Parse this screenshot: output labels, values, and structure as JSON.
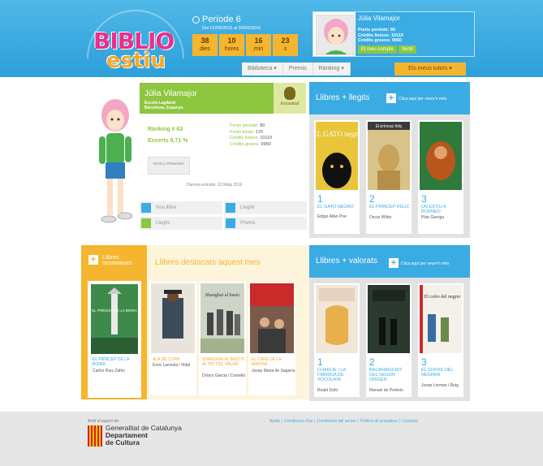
{
  "logo": {
    "line1": "BIBLIO",
    "line2": "estiu"
  },
  "period": {
    "title": "Període 6",
    "dates": "Del 01/06/2016 al 30/06/2016"
  },
  "countdown": [
    {
      "value": "38",
      "unit": "dies"
    },
    {
      "value": "10",
      "unit": "hores"
    },
    {
      "value": "16",
      "unit": "min"
    },
    {
      "value": "23",
      "unit": "s"
    }
  ],
  "user": {
    "name": "Júlia Vilamajor",
    "stats": [
      "Punts període: 80",
      "Crèdits lleixos: 10110",
      "Crèdits gresos: 9950"
    ],
    "account_btn": "El meu compte",
    "logout_btn": "Sortir"
  },
  "nav": {
    "items": [
      "Biblioteca ▾",
      "Premis",
      "Rànking ▾"
    ],
    "tutor": "Els meus tutors ▾"
  },
  "profile": {
    "name": "Júlia Vilamajor",
    "school": "Escola Lagiland",
    "location": "Barcelona, Espanya",
    "badge": "Escarabat",
    "ranking": "Rànking # 63",
    "encerts": "Encerts 9,71 %",
    "stats": [
      {
        "label": "Punts període:",
        "value": "80"
      },
      {
        "label": "Punts totals:",
        "value": "170"
      },
      {
        "label": "Crèdits lleixos:",
        "value": "10110"
      },
      {
        "label": "Crèdits gresos:",
        "value": "9950"
      }
    ],
    "level_btn": "NIVELL PRIMARIA",
    "last_access": "Darrera entrada: 22 Maig 2016"
  },
  "quick_links": [
    {
      "label": "Nou llibre",
      "color": "blue"
    },
    {
      "label": "Llegint",
      "color": "blue"
    },
    {
      "label": "Llegits",
      "color": "green"
    },
    {
      "label": "Premis",
      "color": "blue"
    }
  ],
  "most_read": {
    "title": "Llibres + llegits",
    "click": "Clica aquí per veure'n més",
    "books": [
      {
        "num": "1",
        "title": "EL GATO NEGRO",
        "author": "Edgar Allan Poe",
        "cover_text": "EL GATO negro"
      },
      {
        "num": "2",
        "title": "EL PRÍNCEP FELIÇ",
        "author": "Oscar Wilde",
        "cover_text": "El príncep feliç"
      },
      {
        "num": "3",
        "title": "UN ESTIU A BORNEO",
        "author": "Pilar Garriga",
        "cover_text": ""
      }
    ]
  },
  "recommended": {
    "title": "Llibres recomanats",
    "book": {
      "title": "EL PRÍNCEP DE LA BOIRA",
      "author": "Carlos Ruiz Zafón",
      "cover_text": "EL PRÍNCEP DE LA BOIRA"
    }
  },
  "featured": {
    "title": "Llibres destacats aquest mes",
    "books": [
      {
        "title": "ALA DE CORB",
        "author": "Enric Larreula i Vidal"
      },
      {
        "title": "SHANGHAI AL BASTÓ, AL PIC DEL VALOR",
        "author": "Dolors Garcia i Cornellà",
        "cover_text": "Shanghai al basto"
      },
      {
        "title": "EL CAFÈ DE LA MARINA",
        "author": "Josep Maria de Sagarra"
      }
    ]
  },
  "top_rated": {
    "title": "Llibres + valorats",
    "click": "Clica aquí per veure'n més",
    "books": [
      {
        "num": "1",
        "title": "CHARLIE I LA FÀBRICA DE XOCOLATA",
        "author": "Roald Dahl"
      },
      {
        "num": "2",
        "title": "BACANAISCRIT DEL SEGON ORIGEN",
        "author": "Manuel de Pedrolo"
      },
      {
        "num": "3",
        "title": "EL COFRE DEL NEGRER",
        "author": "Josep Lorman i Roig",
        "cover_text": "El cofre del negrer"
      }
    ]
  },
  "footer": {
    "support": "Amb el suport de:",
    "org1": "Generalitat de Catalunya",
    "org2": "Departament",
    "org3": "de Cultura",
    "links": [
      "Ajuda",
      "Condicions d'ús",
      "Condicions del servei",
      "Política de privadesa",
      "Contacte"
    ]
  },
  "colors": {
    "blue": "#3aabe3",
    "green": "#8dc63f",
    "orange": "#f6b52e",
    "pink": "#e8308a"
  }
}
